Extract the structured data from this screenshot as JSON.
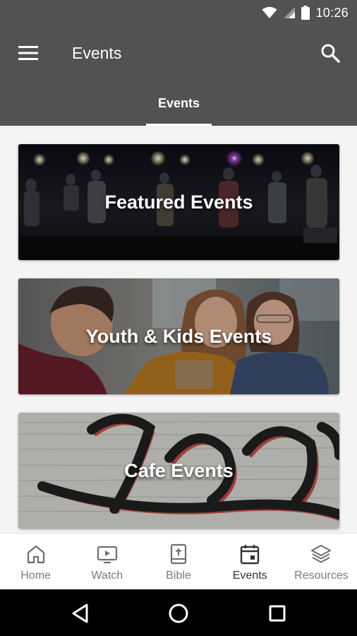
{
  "status_bar": {
    "time": "10:26",
    "icons": [
      "wifi-icon",
      "signal-icon",
      "battery-icon"
    ]
  },
  "app_bar": {
    "title": "Events",
    "menu_icon": "hamburger-menu-icon",
    "search_icon": "search-icon"
  },
  "tabs": [
    {
      "label": "Events",
      "active": true
    }
  ],
  "cards": [
    {
      "label": "Featured Events"
    },
    {
      "label": "Youth & Kids Events"
    },
    {
      "label": "Cafe Events"
    }
  ],
  "bottom_nav": [
    {
      "label": "Home",
      "icon": "home-icon",
      "active": false
    },
    {
      "label": "Watch",
      "icon": "tv-icon",
      "active": false
    },
    {
      "label": "Bible",
      "icon": "bible-icon",
      "active": false
    },
    {
      "label": "Events",
      "icon": "calendar-icon",
      "active": true
    },
    {
      "label": "Resources",
      "icon": "layers-icon",
      "active": false
    }
  ],
  "system_nav": {
    "icons": [
      "back-icon",
      "home-circle-icon",
      "recents-icon"
    ]
  },
  "colors": {
    "app_bar": "#525252",
    "content_bg": "#f4f4f4",
    "nav_text": "#7a7a7a",
    "nav_text_active": "#333333"
  }
}
